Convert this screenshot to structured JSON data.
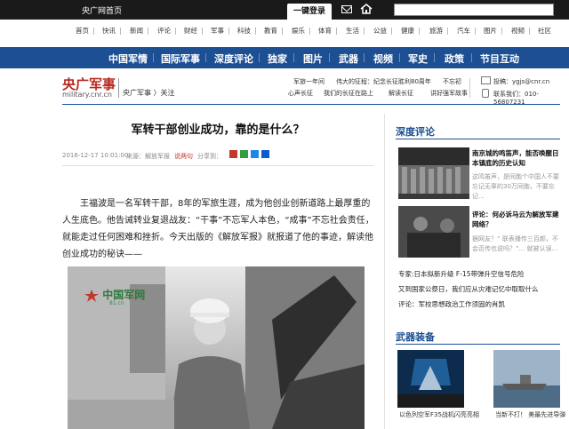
{
  "topbar": {
    "home": "央广网首页",
    "login": "一键登录",
    "icons": [
      "mail-icon",
      "home-icon"
    ]
  },
  "channels": [
    "首页",
    "快讯",
    "新闻",
    "评论",
    "财经",
    "军事",
    "科技",
    "教育",
    "娱乐",
    "体育",
    "生活",
    "公益",
    "健康",
    "旅游",
    "汽车",
    "图片",
    "视频",
    "社区"
  ],
  "main_nav": [
    "中国军情",
    "国际军事",
    "深度评论",
    "独家",
    "图片",
    "武器",
    "视频",
    "军史",
    "政策",
    "节目互动"
  ],
  "site": {
    "logo": "央广军事",
    "domain": "military.cnr.cn",
    "breadcrumb": "央广军事 〉关注"
  },
  "header_links": {
    "row1": [
      "军旅一年间",
      "伟大的征程：纪念长征胜利80周年",
      "不忘初"
    ],
    "row2": [
      "心声长征",
      "我们的长征在路上",
      "解读长征",
      "讲好强军故事"
    ]
  },
  "header_right": {
    "qr_label": "投稿：ygjs@cnr.cn",
    "phone_label": "联系我们：010-56807231"
  },
  "article": {
    "title": "军转干部创业成功，靠的是什么？",
    "time": "2016-12-17 10:01:00",
    "source": "来源：解放军报",
    "comments": "说两句",
    "share": "分享到：",
    "body": "王福波是一名军转干部，8年的军旅生涯，成为他创业创新道路上最厚重的人生底色。他告诫转业复退战友：“干事”不忘军人本色，“成事”不忘社会责任，就能走过任何困难和挫折。今天出版的《解放军报》就报道了他的事迹，解读他创业成功的秘诀——",
    "photo_logo": "中国军网",
    "photo_logo_sub": "81.cn"
  },
  "sidebar": {
    "section1": "深度评论",
    "items": [
      {
        "title": "南京城的鸣笛声，能否唤醒日本镇底的历史认知",
        "desc": "这鸣笛声，是同胞个中国人不要忘记无辜的30万同胞，不要忘记..."
      },
      {
        "title": "评论：何必诉马云为解放军建网络？",
        "desc": "据网友？“ 联表播传三百颜，不会否传也说吗？”... 就被认误..."
      }
    ],
    "list": [
      "专家:日本拟新升级 F-15带弹升空信号危险",
      "又到国家公祭日，我们应从灾难记忆中取取什么",
      "评论：军校思想政治工作须固的肖凯"
    ],
    "section2": "武器装备",
    "weapons": [
      {
        "caption": "以色列空军F35战机闪亮亮相"
      },
      {
        "caption": "当新不打！ 美最先进导弹"
      }
    ]
  }
}
